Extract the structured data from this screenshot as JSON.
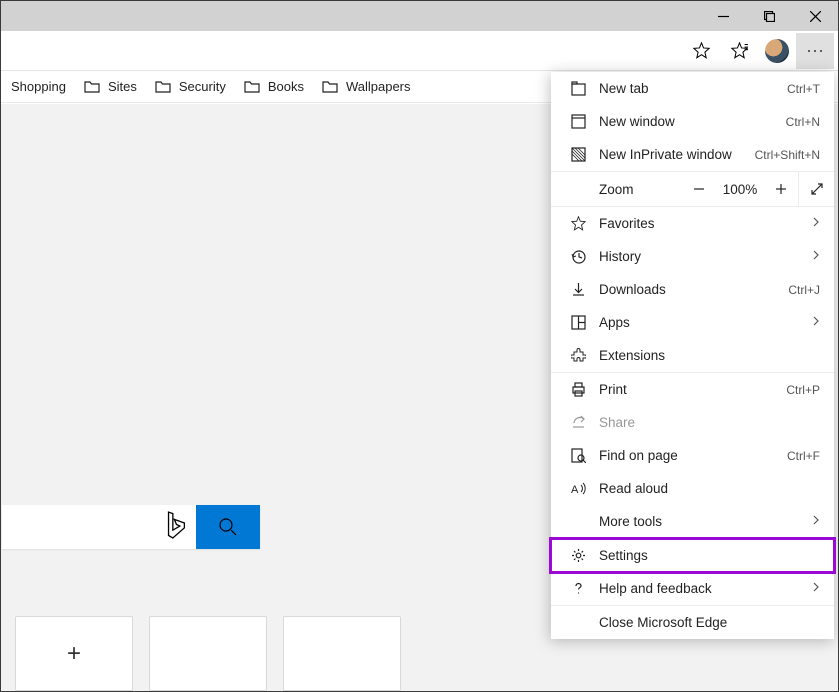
{
  "bookmarks": [
    {
      "label": "Shopping",
      "folder": false
    },
    {
      "label": "Sites",
      "folder": true
    },
    {
      "label": "Security",
      "folder": true
    },
    {
      "label": "Books",
      "folder": true
    },
    {
      "label": "Wallpapers",
      "folder": true
    }
  ],
  "menu": {
    "new_tab": "New tab",
    "new_tab_key": "Ctrl+T",
    "new_window": "New window",
    "new_window_key": "Ctrl+N",
    "new_inprivate": "New InPrivate window",
    "new_inprivate_key": "Ctrl+Shift+N",
    "zoom_label": "Zoom",
    "zoom_value": "100%",
    "favorites": "Favorites",
    "history": "History",
    "downloads": "Downloads",
    "downloads_key": "Ctrl+J",
    "apps": "Apps",
    "extensions": "Extensions",
    "print": "Print",
    "print_key": "Ctrl+P",
    "share": "Share",
    "find": "Find on page",
    "find_key": "Ctrl+F",
    "read_aloud": "Read aloud",
    "more_tools": "More tools",
    "settings": "Settings",
    "help": "Help and feedback",
    "close": "Close Microsoft Edge"
  }
}
